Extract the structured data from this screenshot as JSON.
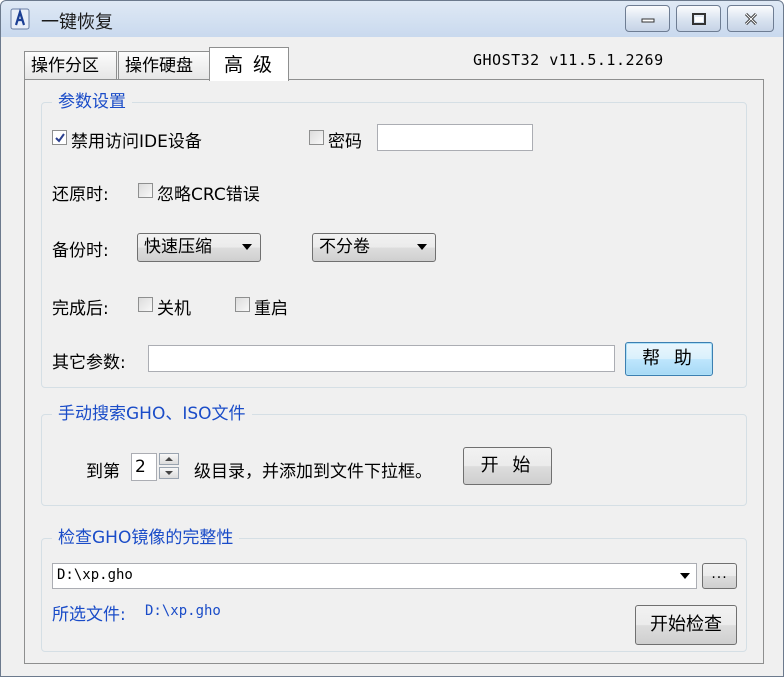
{
  "window": {
    "title": "一键恢复",
    "icon": "ghost-app-icon",
    "version": "GHOST32 v11.5.1.2269"
  },
  "tabs": [
    {
      "label": "操作分区",
      "active": false
    },
    {
      "label": "操作硬盘",
      "active": false
    },
    {
      "label": "高 级",
      "active": true
    }
  ],
  "params": {
    "legend": "参数设置",
    "disable_ide": {
      "label": "禁用访问IDE设备",
      "checked": true
    },
    "password": {
      "label": "密码",
      "checked": false,
      "value": ""
    },
    "restore": {
      "label": "还原时:",
      "ignore_crc": {
        "label": "忽略CRC错误",
        "checked": false
      }
    },
    "backup": {
      "label": "备份时:",
      "compression": "快速压缩",
      "split": "不分卷"
    },
    "after": {
      "label": "完成后:",
      "shutdown": {
        "label": "关机",
        "checked": false
      },
      "reboot": {
        "label": "重启",
        "checked": false
      }
    },
    "other": {
      "label": "其它参数:",
      "value": ""
    },
    "help_button": "帮 助"
  },
  "search": {
    "legend": "手动搜索GHO、ISO文件",
    "prefix": "到第",
    "level": "2",
    "suffix": "级目录，并添加到文件下拉框。",
    "start_button": "开 始"
  },
  "check": {
    "legend": "检查GHO镜像的完整性",
    "file": "D:\\xp.gho",
    "browse_button": "...",
    "selected_label": "所选文件:",
    "selected_value": "D:\\xp.gho",
    "check_button": "开始检查"
  },
  "colors": {
    "accent": "#1a4cc8"
  }
}
